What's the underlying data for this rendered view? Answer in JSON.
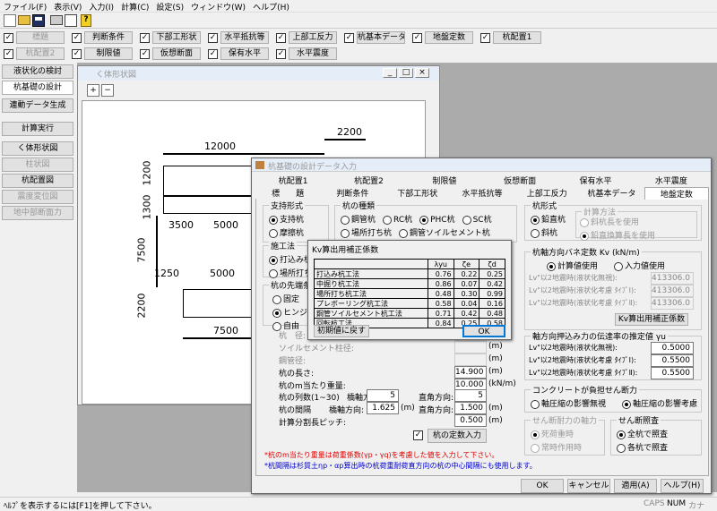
{
  "menu": [
    "ファイル(F)",
    "表示(V)",
    "入力(I)",
    "計算(C)",
    "設定(S)",
    "ウィンドウ(W)",
    "ヘルプ(H)"
  ],
  "checks_row1": [
    {
      "label": "標題",
      "disabled": true
    },
    {
      "label": "判断条件"
    },
    {
      "label": "下部工形状"
    },
    {
      "label": "水平抵抗等"
    },
    {
      "label": "上部工反力"
    },
    {
      "label": "杭基本データ"
    },
    {
      "label": "地盤定数"
    },
    {
      "label": "杭配置1"
    }
  ],
  "checks_row2": [
    {
      "label": "杭配置2",
      "disabled": true
    },
    {
      "label": "制限値"
    },
    {
      "label": "仮想断面"
    },
    {
      "label": "保有水平"
    },
    {
      "label": "水平震度"
    }
  ],
  "sidebar": [
    "液状化の検討",
    "杭基礎の設計",
    "連動データ生成",
    "計算実行",
    "く体形状図",
    "柱状図",
    "杭配置図",
    "震度変位図",
    "地中部断面力"
  ],
  "drawing": {
    "title": "く体形状図",
    "dims": [
      "12000",
      "2200",
      "1200",
      "1300",
      "3500",
      "5000",
      "7500",
      "1250",
      "5000",
      "2200",
      "7500"
    ]
  },
  "dialog": {
    "title": "杭基礎の設計データ入力",
    "tabs_top": [
      "杭配置1",
      "杭配置2",
      "制限値",
      "仮想断面",
      "保有水平",
      "水平震度"
    ],
    "tabs_bottom": [
      "標　　題",
      "判断条件",
      "下部工形状",
      "水平抵抗等",
      "上部工反力",
      "杭基本データ",
      "地盤定数"
    ],
    "support": {
      "label": "支持形式",
      "opts": [
        "支持杭",
        "摩擦杭"
      ]
    },
    "piletype": {
      "label": "杭の種類",
      "opts": [
        "鋼管杭",
        "RC杭",
        "PHC杭",
        "SC杭",
        "場所打ち杭",
        "鋼管ソイルセメント杭"
      ]
    },
    "method": {
      "label": "施工法",
      "opts": [
        "打込み杭",
        "場所打ち"
      ]
    },
    "tip": {
      "label": "杭の先端条件",
      "opts": [
        "固定",
        "ヒンジ",
        "自由"
      ]
    },
    "props": [
      {
        "label": "杭　径:",
        "value": "",
        "unit": "(m)"
      },
      {
        "label": "ソイルセメント柱径:",
        "value": "",
        "unit": "(m)"
      },
      {
        "label": "鋼管径:",
        "value": "",
        "unit": "(m)"
      },
      {
        "label": "杭の長さ:",
        "value": "14.900",
        "unit": "(m)"
      },
      {
        "label": "杭のm当たり重量:",
        "value": "10.000",
        "unit": "(kN/m)"
      }
    ],
    "rows_label": "杭の列数(1~30)",
    "row_dir1": "橋軸方向:",
    "row_val1": "5",
    "row_dir2": "直角方向:",
    "row_val2": "5",
    "spacing_label": "杭の間隔",
    "sp_dir1": "橋軸方向:",
    "sp_val1": "1.625",
    "sp_unit1": "(m)",
    "sp_dir2": "直角方向:",
    "sp_val2": "1.500",
    "sp_unit2": "(m)",
    "pitch_label": "計算分割長ピッチ:",
    "pitch_val": "0.500",
    "pitch_unit": "(m)",
    "const_btn": "杭の定数入力",
    "note_red": "*杭のm当たり重量は荷重係数(γp・γq)を考慮した値を入力して下さい。",
    "note_blue": "*杭間隔は杉質土ηp・αp算出時の杭荷重耐荷直方向の杭の中心間隔にも使用します。",
    "pileform": {
      "label": "杭形式",
      "opts": [
        "鉛直杭",
        "斜杭"
      ],
      "calc_label": "計算方法",
      "calc_opts": [
        "斜杭長を使用",
        "鉛直換算長を使用"
      ]
    },
    "kv": {
      "label": "杭軸方向バネ定数 Kv (kN/m)",
      "opts": [
        "計算値使用",
        "入力値使用"
      ],
      "rows": [
        {
          "label": "Lv\"以2地震時(液状化無視):",
          "value": "413306.0"
        },
        {
          "label": "Lv\"以2地震時(液状化考慮 ﾀｲﾌﾟⅠ):",
          "value": "413306.0"
        },
        {
          "label": "Lv\"以2地震時(液状化考慮 ﾀｲﾌﾟⅡ):",
          "value": "413306.0"
        }
      ],
      "btn": "Kv算出用補正係数"
    },
    "gamma": {
      "label": "軸方向押込み力の伝達率の推定値 γu",
      "rows": [
        {
          "label": "Lv\"以2地震時(液状化無視):",
          "value": "0.5000"
        },
        {
          "label": "Lv\"以2地震時(液状化考慮 ﾀｲﾌﾟⅠ):",
          "value": "0.5500"
        },
        {
          "label": "Lv\"以2地震時(液状化考慮 ﾀｲﾌﾟⅡ):",
          "value": "0.5500"
        }
      ]
    },
    "shear": {
      "label": "コンクリートが負担せん断力",
      "opts": [
        "軸圧縮の影響無視",
        "軸圧縮の影響考慮"
      ]
    },
    "axial": {
      "label": "せん断耐力の軸力",
      "opts": [
        "死荷重時",
        "常時作用時"
      ]
    },
    "check": {
      "label": "せん断照査",
      "opts": [
        "全杭で照査",
        "各杭で照査"
      ]
    },
    "buttons": [
      "OK",
      "キャンセル",
      "適用(A)",
      "ヘルプ(H)"
    ]
  },
  "kvdlg": {
    "title": "Kv算出用補正係数",
    "headers": [
      "",
      "λyu",
      "ζe",
      "ζd"
    ],
    "rows": [
      [
        "打込み杭工法",
        "0.76",
        "0.22",
        "0.25"
      ],
      [
        "中掘り杭工法",
        "0.86",
        "0.07",
        "0.42"
      ],
      [
        "場所打ち杭工法",
        "0.48",
        "0.30",
        "0.99"
      ],
      [
        "プレボーリング杭工法",
        "0.58",
        "0.04",
        "0.16"
      ],
      [
        "鋼管ソイルセメント杭工法",
        "0.71",
        "0.42",
        "0.48"
      ],
      [
        "回転杭工法",
        "0.84",
        "0.25",
        "0.58"
      ]
    ],
    "reset": "初期値に戻す",
    "ok": "OK"
  },
  "status": {
    "text": "ﾍﾙﾌﾟを表示するには[F1]を押して下さい。",
    "caps": "CAPS",
    "num": "NUM",
    "kana": "カナ"
  }
}
